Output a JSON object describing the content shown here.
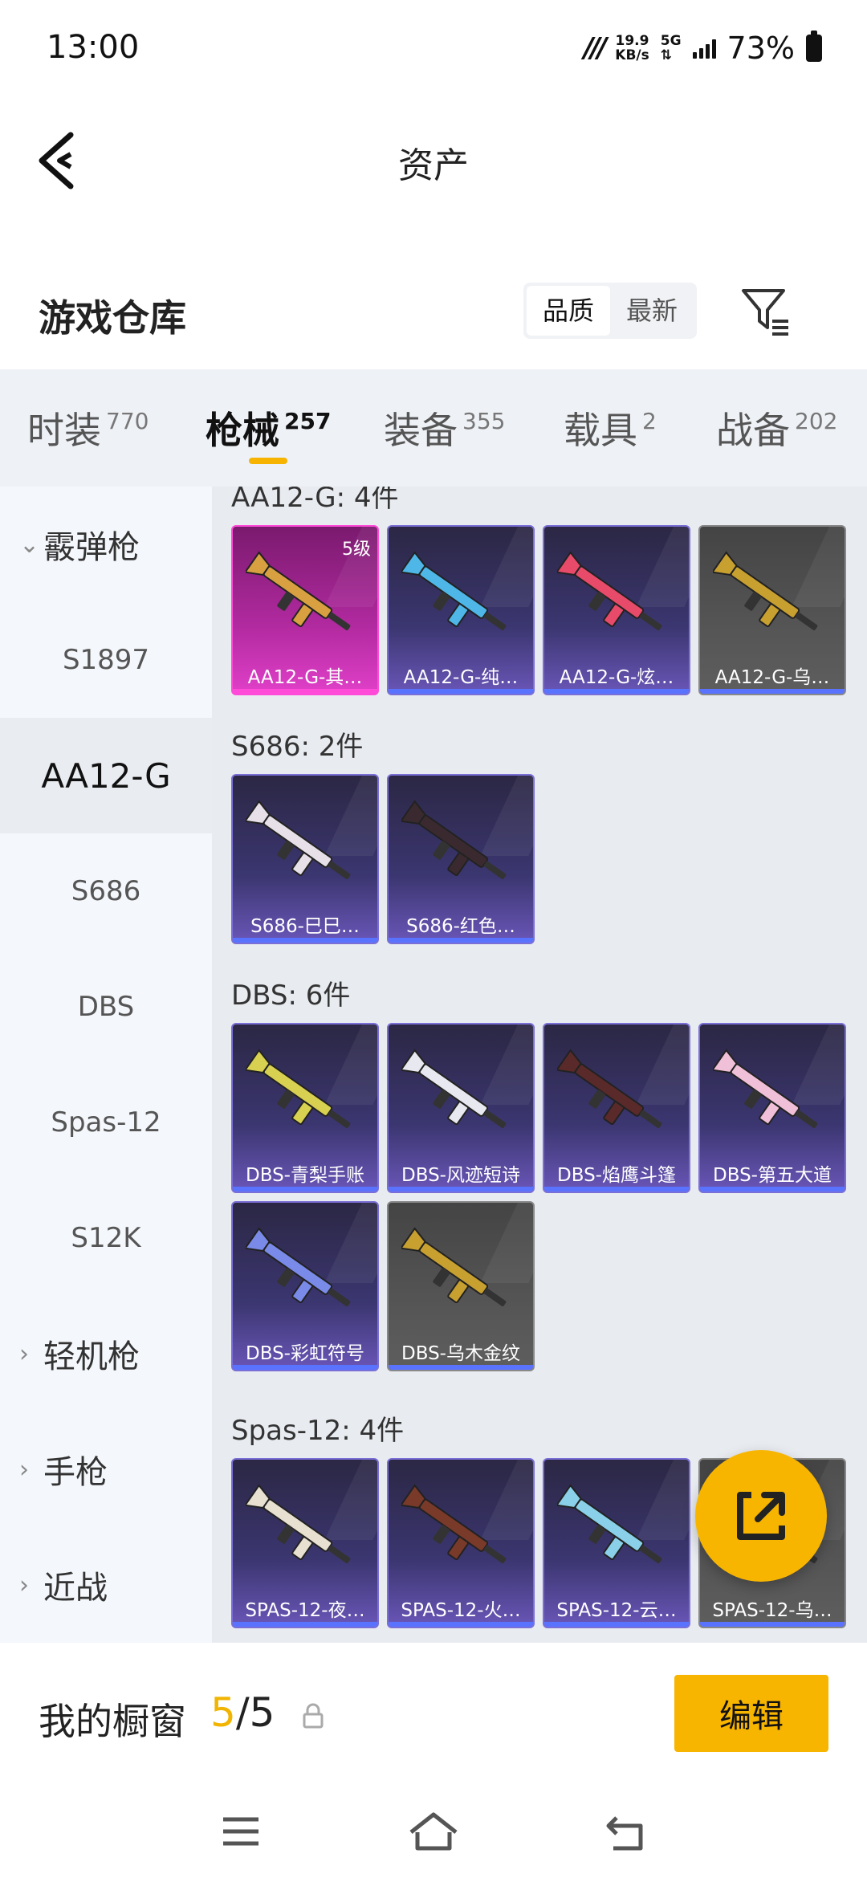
{
  "status": {
    "time": "13:00",
    "speed_value": "19.9",
    "speed_unit": "KB/s",
    "network": "5G",
    "battery": "73%"
  },
  "header": {
    "title": "资产"
  },
  "warehouse": {
    "title": "游戏仓库",
    "sort_options": [
      "品质",
      "最新"
    ],
    "active_sort": "品质"
  },
  "tabs": [
    {
      "label": "时装",
      "count": "770"
    },
    {
      "label": "枪械",
      "count": "257"
    },
    {
      "label": "装备",
      "count": "355"
    },
    {
      "label": "载具",
      "count": "2"
    },
    {
      "label": "战备",
      "count": "202"
    }
  ],
  "active_tab": "枪械",
  "sidebar": {
    "group_shotgun": "霰弹枪",
    "s1897": "S1897",
    "aa12g": "AA12-G",
    "s686": "S686",
    "dbs": "DBS",
    "spas12": "Spas-12",
    "s12k": "S12K",
    "group_lmg": "轻机枪",
    "group_pistol": "手枪",
    "group_melee": "近战"
  },
  "sections": {
    "aa12": {
      "title": "AA12-G: 4件",
      "items": [
        {
          "name": "AA12-G-其…",
          "level": "5级",
          "rarity": "gold",
          "color": "#d8a040"
        },
        {
          "name": "AA12-G-纯…",
          "rarity": "purple",
          "color": "#4fb7e8"
        },
        {
          "name": "AA12-G-炫…",
          "rarity": "purple",
          "color": "#e84a6a"
        },
        {
          "name": "AA12-G-乌…",
          "rarity": "grey",
          "color": "#c8a030"
        }
      ]
    },
    "s686": {
      "title": "S686: 2件",
      "items": [
        {
          "name": "S686-巳巳…",
          "rarity": "purple",
          "color": "#e8e0e8"
        },
        {
          "name": "S686-红色…",
          "rarity": "purple",
          "color": "#3a2a30"
        }
      ]
    },
    "dbs": {
      "title": "DBS: 6件",
      "items": [
        {
          "name": "DBS-青梨手账",
          "rarity": "purple",
          "color": "#d8d050"
        },
        {
          "name": "DBS-风迹短诗",
          "rarity": "purple",
          "color": "#e8e8f0"
        },
        {
          "name": "DBS-焰鹰斗篷",
          "rarity": "purple",
          "color": "#5a2a2a"
        },
        {
          "name": "DBS-第五大道",
          "rarity": "purple",
          "color": "#f0c0d8"
        },
        {
          "name": "DBS-彩虹符号",
          "rarity": "purple",
          "color": "#7a8ae8"
        },
        {
          "name": "DBS-乌木金纹",
          "rarity": "grey",
          "color": "#c8a030"
        }
      ]
    },
    "spas": {
      "title": "Spas-12: 4件",
      "items": [
        {
          "name": "SPAS-12-夜…",
          "rarity": "purple",
          "color": "#e8e0d0"
        },
        {
          "name": "SPAS-12-火…",
          "rarity": "purple",
          "color": "#7a3a2a"
        },
        {
          "name": "SPAS-12-云…",
          "rarity": "purple",
          "color": "#8ad0e8"
        },
        {
          "name": "SPAS-12-乌…",
          "rarity": "grey",
          "color": "#c8a030"
        }
      ]
    }
  },
  "showcase": {
    "label": "我的橱窗",
    "current": "5",
    "separator": "/",
    "total": "5",
    "edit_label": "编辑"
  },
  "colors": {
    "accent": "#f8b500",
    "tab_underline": "#f6b400"
  }
}
